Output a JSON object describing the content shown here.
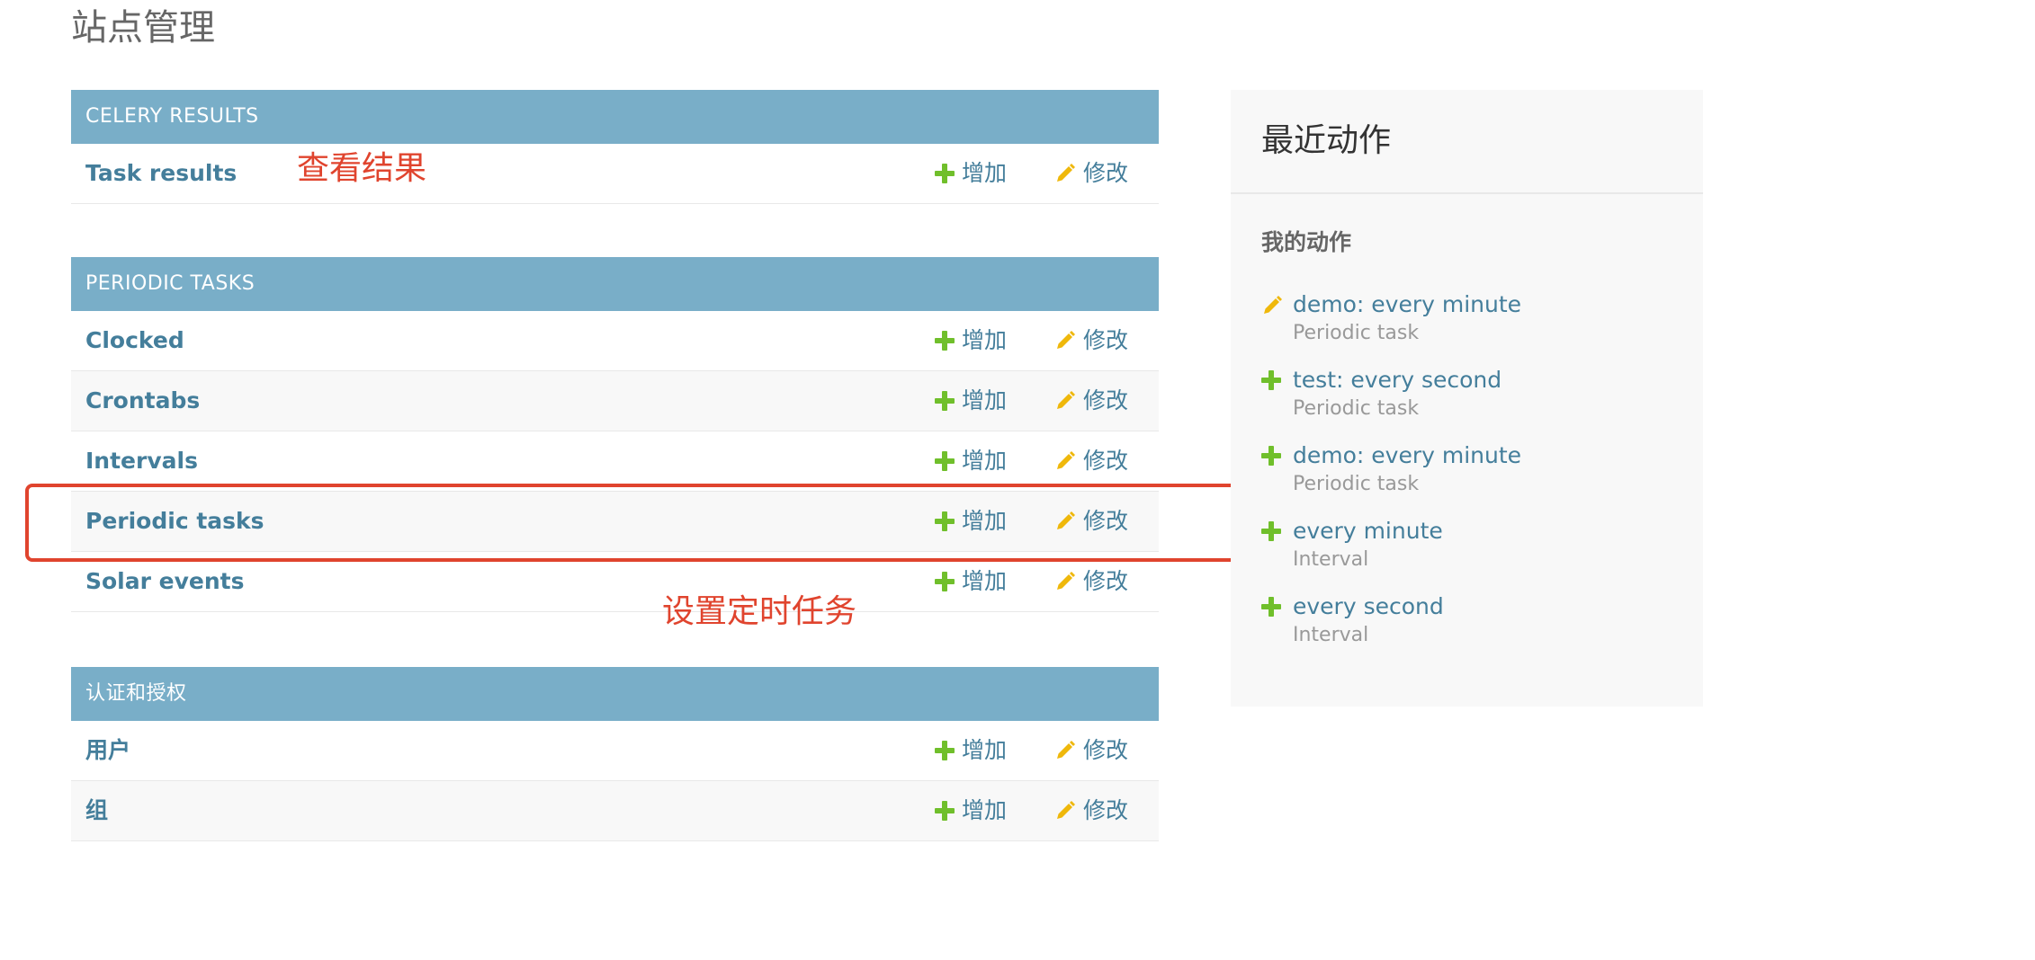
{
  "page": {
    "title": "站点管理"
  },
  "colors": {
    "module_header": "#79aec8",
    "link": "#447e9b",
    "add_icon": "#70bf2b",
    "change_icon": "#efb80b",
    "annotation": "#e0442e"
  },
  "modules": [
    {
      "header": "CELERY RESULTS",
      "rows": [
        {
          "name": "Task results",
          "add": "增加",
          "change": "修改"
        }
      ]
    },
    {
      "header": "PERIODIC TASKS",
      "rows": [
        {
          "name": "Clocked",
          "add": "增加",
          "change": "修改"
        },
        {
          "name": "Crontabs",
          "add": "增加",
          "change": "修改"
        },
        {
          "name": "Intervals",
          "add": "增加",
          "change": "修改"
        },
        {
          "name": "Periodic tasks",
          "add": "增加",
          "change": "修改"
        },
        {
          "name": "Solar events",
          "add": "增加",
          "change": "修改"
        }
      ]
    },
    {
      "header": "认证和授权",
      "rows": [
        {
          "name": "用户",
          "add": "增加",
          "change": "修改"
        },
        {
          "name": "组",
          "add": "增加",
          "change": "修改"
        }
      ]
    }
  ],
  "annotations": {
    "view_results": "查看结果",
    "set_periodic": "设置定时任务"
  },
  "recent_actions": {
    "title": "最近动作",
    "subtitle": "我的动作",
    "items": [
      {
        "icon": "pencil-icon",
        "label": "demo: every minute",
        "type": "Periodic task"
      },
      {
        "icon": "plus-icon",
        "label": "test: every second",
        "type": "Periodic task"
      },
      {
        "icon": "plus-icon",
        "label": "demo: every minute",
        "type": "Periodic task"
      },
      {
        "icon": "plus-icon",
        "label": "every minute",
        "type": "Interval"
      },
      {
        "icon": "plus-icon",
        "label": "every second",
        "type": "Interval"
      }
    ]
  }
}
